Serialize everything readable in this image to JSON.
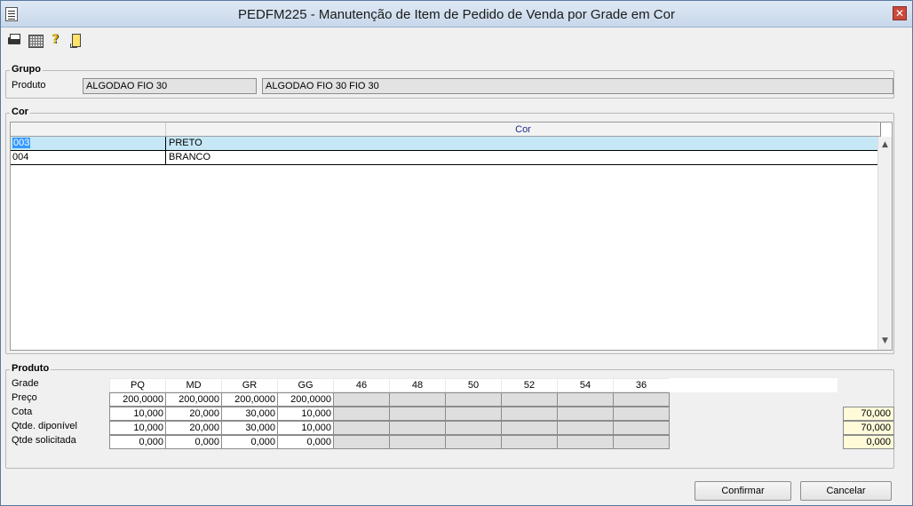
{
  "window": {
    "title": "PEDFM225 - Manutenção de Item de Pedido de Venda por Grade em Cor",
    "close_glyph": "✕"
  },
  "toolbar": {
    "icons": [
      "printer-icon",
      "calculator-icon",
      "help-icon",
      "exit-door-icon"
    ]
  },
  "grupo": {
    "legend": "Grupo",
    "produto_label": "Produto",
    "produto_code": "ALGODAO FIO 30",
    "produto_desc": "ALGODAO FIO 30 FIO 30"
  },
  "cor": {
    "legend": "Cor",
    "column_header": "Cor",
    "rows": [
      {
        "code": "003",
        "name": "PRETO"
      },
      {
        "code": "004",
        "name": "BRANCO"
      }
    ]
  },
  "produto": {
    "legend": "Produto",
    "row_labels": [
      "Grade",
      "Preço",
      "Cota",
      "Qtde. diponível",
      "Qtde solicitada"
    ],
    "sizes": [
      "PQ",
      "MD",
      "GR",
      "GG",
      "46",
      "48",
      "50",
      "52",
      "54",
      "36"
    ],
    "preco": [
      "200,0000",
      "200,0000",
      "200,0000",
      "200,0000"
    ],
    "cota": [
      "10,000",
      "20,000",
      "30,000",
      "10,000"
    ],
    "disponivel": [
      "10,000",
      "20,000",
      "30,000",
      "10,000"
    ],
    "solicitada": [
      "0,000",
      "0,000",
      "0,000",
      "0,000"
    ],
    "totals": {
      "cota": "70,000",
      "disponivel": "70,000",
      "solicitada": "0,000"
    }
  },
  "buttons": {
    "confirmar": "Confirmar",
    "cancelar": "Cancelar"
  },
  "colors": {
    "selected_row": "#c6e8f6",
    "selection_highlight": "#3399ff",
    "total_cell": "#fffbd9",
    "close_button": "#c94a3c"
  }
}
